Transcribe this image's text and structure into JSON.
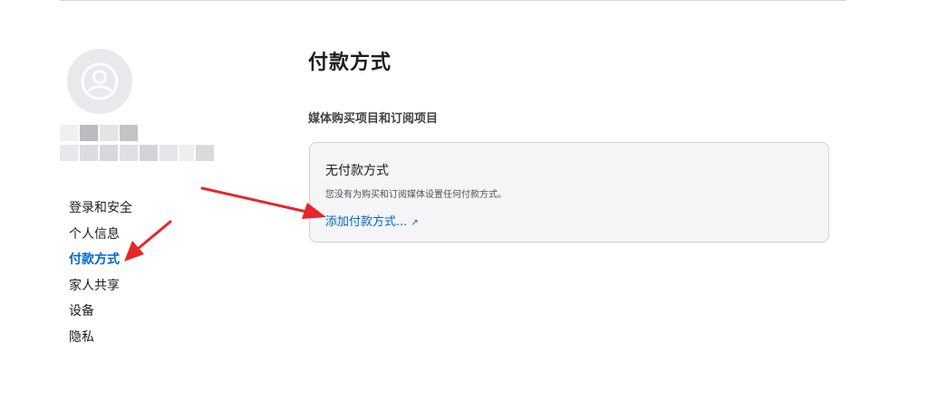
{
  "sidebar": {
    "items": [
      {
        "label": "登录和安全"
      },
      {
        "label": "个人信息"
      },
      {
        "label": "付款方式",
        "active": true
      },
      {
        "label": "家人共享"
      },
      {
        "label": "设备"
      },
      {
        "label": "隐私"
      }
    ]
  },
  "main": {
    "title": "付款方式",
    "section_title": "媒体购买项目和订阅项目",
    "card": {
      "title": "无付款方式",
      "description": "您没有为购买和订阅媒体设置任何付款方式。",
      "link_label": "添加付款方式...",
      "link_icon": "↗"
    }
  },
  "colors": {
    "accent": "#0066cc",
    "annotation_arrow": "#e8252b",
    "card_bg": "#f5f5f7"
  },
  "icons": {
    "avatar": "person-circle-icon",
    "external_link": "external-link-icon"
  }
}
